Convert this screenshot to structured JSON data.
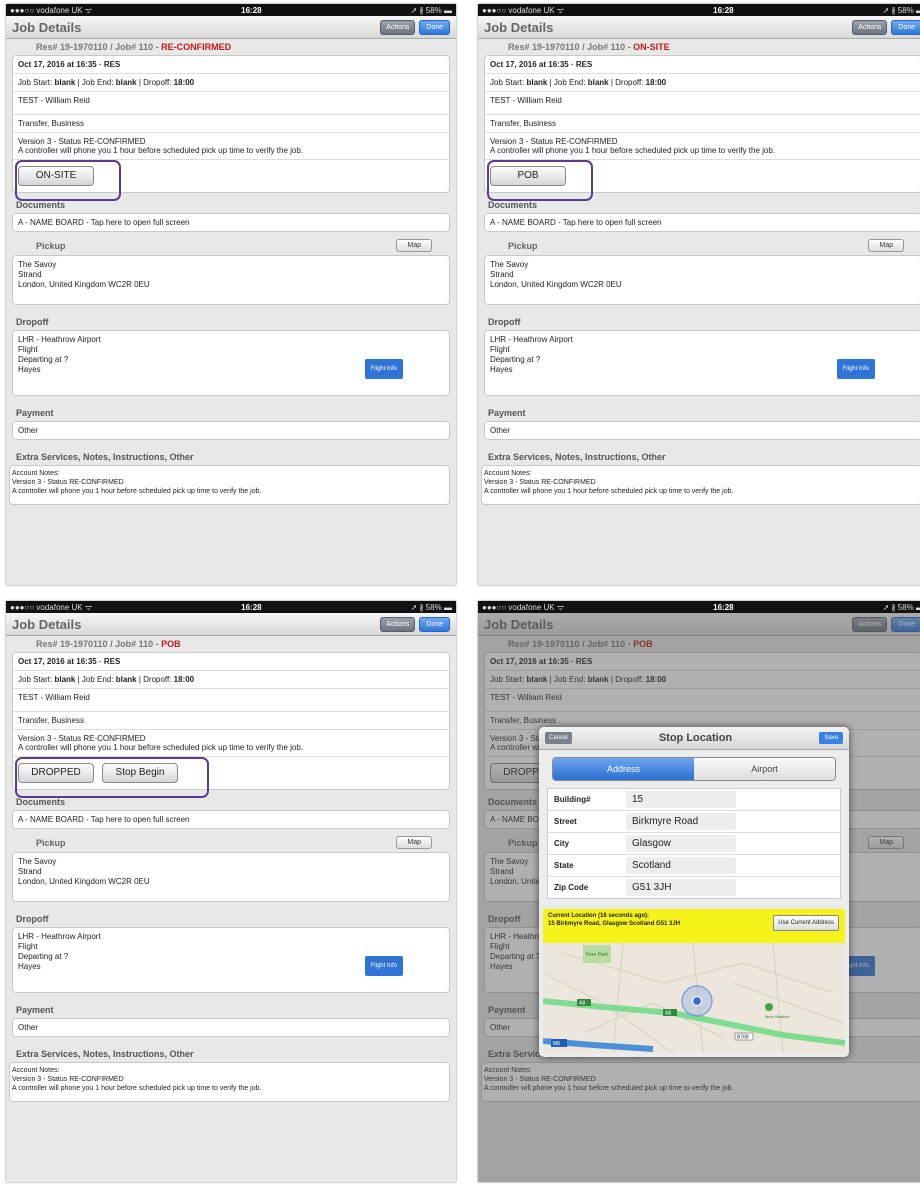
{
  "status": {
    "carrier": "●●●○○ vodafone UK ᯤ",
    "time": "16:28",
    "battery": "➚ ∦ 58% ▬"
  },
  "nav": {
    "title": "Job Details",
    "actions": "Actions",
    "done": "Done"
  },
  "job": {
    "res_prefix": "Res# 19-1970110 / Job# 110 - ",
    "date_line": "Oct 17, 2016 at 16:35 · RES",
    "start_label": "Job Start: ",
    "start_value": "blank",
    "end_label": " | Job End: ",
    "end_value": "blank",
    "dropoff_label": " | Dropoff: ",
    "dropoff_value": "18:00",
    "passenger": "TEST - William Reid",
    "service": "Transfer, Business",
    "version": "Version 3 - Status RE-CONFIRMED",
    "controller_note": "A controller will phone you 1 hour before scheduled pick up time to verify the job."
  },
  "sections": {
    "documents": "Documents",
    "document_item": "A - NAME BOARD - Tap here to open full screen",
    "pickup": "Pickup",
    "map": "Map",
    "pickup_lines": [
      "The Savoy",
      "Strand",
      "London, United Kingdom WC2R 0EU"
    ],
    "dropoff": "Dropoff",
    "dropoff_lines": [
      "LHR - Heathrow Airport",
      "Flight",
      "Departing at ?",
      "Hayes"
    ],
    "flight_info": "Flight Info",
    "payment": "Payment",
    "payment_value": "Other",
    "extra": "Extra Services, Notes, Instructions, Other",
    "notes_lines": [
      "Account Notes:",
      "Version 3 - Status RE-CONFIRMED",
      "A controller will phone you 1 hour before scheduled pick up time to verify the job."
    ]
  },
  "panels": [
    {
      "status": "RE-CONFIRMED",
      "buttons": [
        "ON-SITE"
      ]
    },
    {
      "status": "ON-SITE",
      "buttons": [
        "POB"
      ]
    },
    {
      "status": "POB",
      "buttons": [
        "DROPPED",
        "Stop Begin"
      ]
    },
    {
      "status": "POB",
      "buttons": [
        "DROPPED"
      ]
    }
  ],
  "modal": {
    "cancel": "Cancel",
    "title": "Stop Location",
    "save": "Save",
    "tab_address": "Address",
    "tab_airport": "Airport",
    "fields": [
      {
        "label": "Building#",
        "value": "15"
      },
      {
        "label": "Street",
        "value": "Birkmyre Road"
      },
      {
        "label": "City",
        "value": "Glasgow"
      },
      {
        "label": "State",
        "value": "Scotland"
      },
      {
        "label": "Zip Code",
        "value": "G51 3JH"
      }
    ],
    "current_location_title": "Current Location (16 seconds ago):",
    "current_location_addr": "15 Birkmyre Road, Glasgow Scotland G51 3JH",
    "use_current": "Use Current Address",
    "map_labels": {
      "park": "Fern Park",
      "stadium": "Ibrox Stadium",
      "road_a": "A8",
      "road_m": "M8",
      "road_b": "B768"
    }
  },
  "colors": {
    "accent": "#2f78d8",
    "status_red": "#c21818",
    "highlight": "#5a3b8c",
    "location_yellow": "#f5f31a"
  }
}
